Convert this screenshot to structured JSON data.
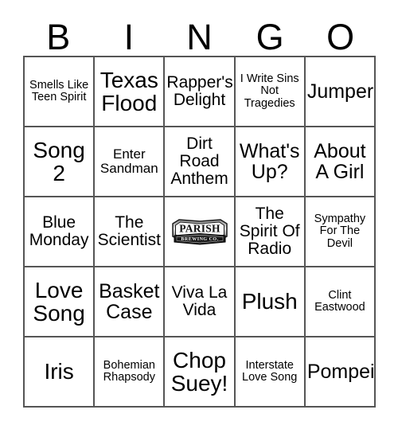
{
  "header": {
    "letters": [
      "B",
      "I",
      "N",
      "G",
      "O"
    ]
  },
  "grid": {
    "rows": [
      [
        {
          "text": "Smells Like Teen Spirit",
          "size": "xs"
        },
        {
          "text": "Texas Flood",
          "size": "xl"
        },
        {
          "text": "Rapper's Delight",
          "size": "md"
        },
        {
          "text": "I Write Sins Not Tragedies",
          "size": "xs"
        },
        {
          "text": "Jumper",
          "size": "lg"
        }
      ],
      [
        {
          "text": "Song 2",
          "size": "xl"
        },
        {
          "text": "Enter Sandman",
          "size": "sm"
        },
        {
          "text": "Dirt Road Anthem",
          "size": "md"
        },
        {
          "text": "What's Up?",
          "size": "lg"
        },
        {
          "text": "About A Girl",
          "size": "lg"
        }
      ],
      [
        {
          "text": "Blue Monday",
          "size": "md"
        },
        {
          "text": "The Scientist",
          "size": "md"
        },
        {
          "text": "",
          "size": "md",
          "logo": "parish-brewing-co"
        },
        {
          "text": "The Spirit Of Radio",
          "size": "md"
        },
        {
          "text": "Sympathy For The Devil",
          "size": "xs"
        }
      ],
      [
        {
          "text": "Love Song",
          "size": "xl"
        },
        {
          "text": "Basket Case",
          "size": "lg"
        },
        {
          "text": "Viva La Vida",
          "size": "md"
        },
        {
          "text": "Plush",
          "size": "xl"
        },
        {
          "text": "Clint Eastwood",
          "size": "xs"
        }
      ],
      [
        {
          "text": "Iris",
          "size": "xl"
        },
        {
          "text": "Bohemian Rhapsody",
          "size": "xs"
        },
        {
          "text": "Chop Suey!",
          "size": "xl"
        },
        {
          "text": "Interstate Love Song",
          "size": "xs"
        },
        {
          "text": "Pompeii",
          "size": "lg"
        }
      ]
    ]
  },
  "logo": {
    "name": "parish-brewing-co",
    "primary_text": "PARISH",
    "ribbon_text": "BREWING CO.",
    "colors": {
      "dark": "#1c1c1c",
      "mid": "#4a4a4a",
      "light": "#f2f2f2"
    }
  },
  "colors": {
    "border": "#555555",
    "text": "#000000",
    "background": "#ffffff"
  }
}
